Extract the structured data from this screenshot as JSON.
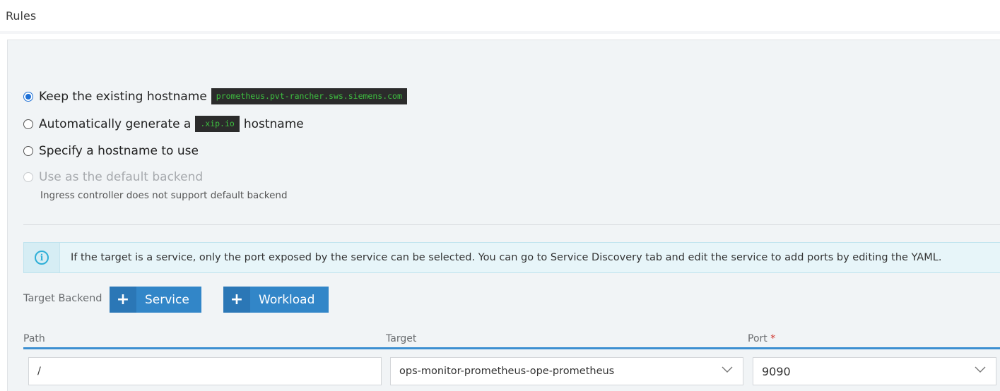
{
  "section": {
    "title": "Rules"
  },
  "hostname_options": {
    "keep_existing": {
      "label": "Keep the existing hostname",
      "value": "prometheus.pvt-rancher.sws.siemens.com",
      "selected": true
    },
    "auto_generate": {
      "label_before": "Automatically generate a",
      "code": ".xip.io",
      "label_after": "hostname",
      "selected": false
    },
    "specify": {
      "label": "Specify a hostname to use",
      "selected": false
    },
    "default_backend": {
      "label": "Use as the default backend",
      "note": "Ingress controller does not support default backend",
      "disabled": true
    }
  },
  "info": {
    "icon": "info-circle-icon",
    "text": "If the target is a service, only the port exposed by the service can be selected. You can go to Service Discovery tab and edit the service to add ports by editing the YAML."
  },
  "target_backend": {
    "label": "Target Backend",
    "service_button": "Service",
    "workload_button": "Workload",
    "plus_glyph": "+"
  },
  "rule_table": {
    "headers": {
      "path": "Path",
      "target": "Target",
      "port": "Port",
      "required_mark": "*"
    },
    "row": {
      "path": "/",
      "target": "ops-monitor-prometheus-ope-prometheus",
      "port": "9090"
    }
  },
  "colors": {
    "accent": "#3286c8",
    "code_bg": "#2b2b2b",
    "code_text": "#3ec040",
    "info_bg": "#e7f5f9"
  }
}
